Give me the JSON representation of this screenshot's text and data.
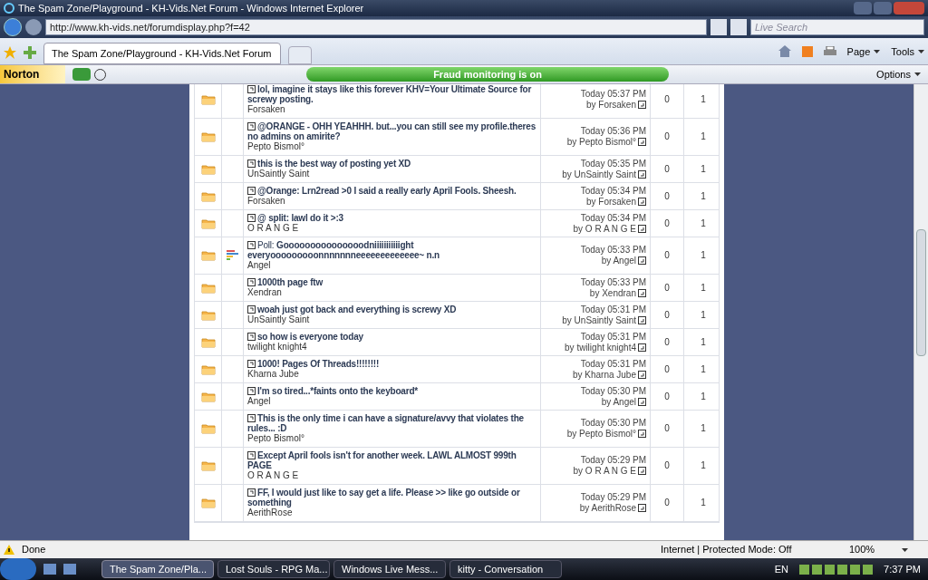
{
  "window": {
    "title": "The Spam Zone/Playground - KH-Vids.Net Forum - Windows Internet Explorer"
  },
  "address": {
    "value": "http://www.kh-vids.net/forumdisplay.php?f=42"
  },
  "search": {
    "placeholder": "Live Search"
  },
  "tab": {
    "label": "The Spam Zone/Playground - KH-Vids.Net Forum",
    "selected": true
  },
  "command_bar": [
    {
      "label": "Page"
    },
    {
      "label": "Tools"
    }
  ],
  "norton": {
    "logo": "Norton",
    "banner": "Fraud monitoring is on",
    "options": "Options"
  },
  "threads": [
    {
      "kind": "normal",
      "title": "lol, imagine it stays like this forever KHV=Your Ultimate Source for screwy posting.",
      "author": "Forsaken",
      "time": "Today 05:37 PM",
      "last_by": "by Forsaken",
      "replies": "0",
      "views": "1"
    },
    {
      "kind": "normal",
      "title": "@ORANGE - OHH YEAHHH. but...you can still see my profile.theres no admins on amirite?",
      "author": "Pepto Bismol°",
      "time": "Today 05:36 PM",
      "last_by": "by Pepto Bismol°",
      "replies": "0",
      "views": "1"
    },
    {
      "kind": "normal",
      "title": "this is the best way of posting yet XD",
      "author": "UnSaintly Saint",
      "time": "Today 05:35 PM",
      "last_by": "by UnSaintly Saint",
      "replies": "0",
      "views": "1"
    },
    {
      "kind": "normal",
      "title": "@Orange: Lrn2read >0 I said a really early April Fools. Sheesh.",
      "author": "Forsaken",
      "time": "Today 05:34 PM",
      "last_by": "by Forsaken",
      "replies": "0",
      "views": "1"
    },
    {
      "kind": "normal",
      "title": "@ split: lawl do it >:3",
      "author": "O R A N G E",
      "time": "Today 05:34 PM",
      "last_by": "by O R A N G E",
      "replies": "0",
      "views": "1"
    },
    {
      "kind": "poll",
      "prefix": "Poll:",
      "title": "Gooooooooooooooodniiiiiiiiiiight everyooooooooonnnnnnneeeeeeeeeeeee~ n.n",
      "author": "Angel",
      "time": "Today 05:33 PM",
      "last_by": "by Angel",
      "replies": "0",
      "views": "1"
    },
    {
      "kind": "normal",
      "title": "1000th page ftw",
      "author": "Xendran",
      "time": "Today 05:33 PM",
      "last_by": "by Xendran",
      "replies": "0",
      "views": "1"
    },
    {
      "kind": "normal",
      "title": "woah just got back and everything is screwy XD",
      "author": "UnSaintly Saint",
      "time": "Today 05:31 PM",
      "last_by": "by UnSaintly Saint",
      "replies": "0",
      "views": "1"
    },
    {
      "kind": "normal",
      "title": "so how is everyone today",
      "author": "twilight knight4",
      "time": "Today 05:31 PM",
      "last_by": "by twilight knight4",
      "replies": "0",
      "views": "1"
    },
    {
      "kind": "normal",
      "title": "1000! Pages Of Threads!!!!!!!!",
      "author": "Kharna Jube",
      "time": "Today 05:31 PM",
      "last_by": "by Kharna Jube",
      "replies": "0",
      "views": "1"
    },
    {
      "kind": "normal",
      "title": "I'm so tired...*faints onto the keyboard*",
      "author": "Angel",
      "time": "Today 05:30 PM",
      "last_by": "by Angel",
      "replies": "0",
      "views": "1"
    },
    {
      "kind": "normal",
      "title": "This is the only time i can have a signature/avvy that violates the rules... :D",
      "author": "Pepto Bismol°",
      "time": "Today 05:30 PM",
      "last_by": "by Pepto Bismol°",
      "replies": "0",
      "views": "1"
    },
    {
      "kind": "normal",
      "title": "Except April fools isn't for another week. LAWL ALMOST 999th PAGE",
      "author": "O R A N G E",
      "time": "Today 05:29 PM",
      "last_by": "by O R A N G E",
      "replies": "0",
      "views": "1"
    },
    {
      "kind": "normal",
      "title": "FF, I would just like to say get a life. Please >> like go outside or something",
      "author": "AerithRose",
      "time": "Today 05:29 PM",
      "last_by": "by AerithRose",
      "replies": "0",
      "views": "1"
    }
  ],
  "status_bar": {
    "text": "Done",
    "zone": "Internet | Protected Mode: Off",
    "zoom": "100%"
  },
  "taskbar": {
    "items": [
      {
        "label": "The Spam Zone/Pla...",
        "selected": true
      },
      {
        "label": "Lost Souls - RPG Ma...",
        "selected": false
      },
      {
        "label": "Windows Live Mess...",
        "selected": false
      },
      {
        "label": "kitty - Conversation",
        "selected": false
      }
    ],
    "lang": "EN",
    "clock": "7:37 PM"
  }
}
